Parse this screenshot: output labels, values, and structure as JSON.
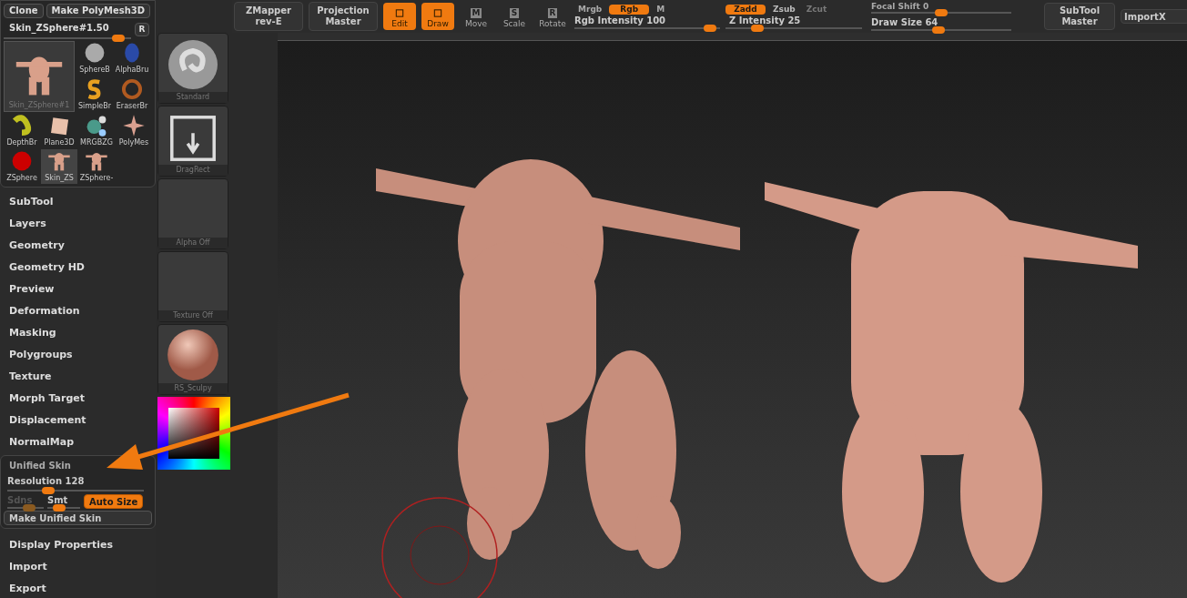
{
  "tool_palette": {
    "buttons": [
      "Clone",
      "Make PolyMesh3D"
    ],
    "current_tool": {
      "label": "Skin_ZSphere#1.50",
      "level": 0.9
    },
    "reset_button": "R",
    "tools": [
      {
        "label": "Skin_ZSphere#1",
        "kind": "figure",
        "selected": true
      },
      {
        "label": "SphereB",
        "kind": "sphere",
        "selected": false
      },
      {
        "label": "AlphaBru",
        "kind": "alpha",
        "selected": false
      },
      {
        "label": "SimpleBr",
        "kind": "simple",
        "selected": false
      },
      {
        "label": "EraserBr",
        "kind": "eraser",
        "selected": false
      },
      {
        "label": "DepthBr",
        "kind": "depth",
        "selected": false
      },
      {
        "label": "Plane3D",
        "kind": "plane",
        "selected": false
      },
      {
        "label": "MRGBZG",
        "kind": "mrgb",
        "selected": false
      },
      {
        "label": "PolyMes",
        "kind": "star",
        "selected": false
      },
      {
        "label": "ZSphere",
        "kind": "zsphere",
        "selected": false
      },
      {
        "label": "Skin_ZS",
        "kind": "figure",
        "selected": true
      },
      {
        "label": "ZSphere-",
        "kind": "figure",
        "selected": false
      }
    ]
  },
  "menus_top": [
    "SubTool",
    "Layers",
    "Geometry",
    "Geometry HD",
    "Preview",
    "Deformation",
    "Masking",
    "Polygroups",
    "Texture",
    "Morph Target",
    "Displacement",
    "NormalMap"
  ],
  "unified_skin": {
    "title": "Unified Skin",
    "expanded": true,
    "resolution": {
      "label": "Resolution 128",
      "level": 0.3
    },
    "sdns": {
      "label": "Sdns",
      "disabled": true,
      "level": 0.6
    },
    "smt": {
      "label": "Smt",
      "disabled": false,
      "level": 0.35
    },
    "auto_size": {
      "label": "Auto Size",
      "on": true
    },
    "make_button": "Make Unified Skin"
  },
  "menus_bottom": [
    "Display Properties",
    "Import",
    "Export"
  ],
  "shelf": [
    {
      "label": "Standard",
      "kind": "brush"
    },
    {
      "label": "DragRect",
      "kind": "stroke"
    },
    {
      "label": "Alpha Off",
      "kind": "empty"
    },
    {
      "label": "Texture Off",
      "kind": "empty"
    },
    {
      "label": "RS_Sculpy",
      "kind": "material"
    }
  ],
  "top_bar": {
    "zmapper": [
      "ZMapper",
      "rev-E"
    ],
    "projection": [
      "Projection",
      "Master"
    ],
    "transform": [
      {
        "label": "Edit",
        "on": true
      },
      {
        "label": "Draw",
        "on": true
      },
      {
        "label": "Move",
        "key": "M",
        "on": false
      },
      {
        "label": "Scale",
        "key": "S",
        "on": false
      },
      {
        "label": "Rotate",
        "key": "R",
        "on": false
      }
    ],
    "rgb_modes": [
      {
        "label": "Mrgb",
        "selected": false
      },
      {
        "label": "Rgb",
        "selected": true
      },
      {
        "label": "M",
        "selected": false
      }
    ],
    "z_modes": [
      {
        "label": "Zadd",
        "selected": true,
        "disabled": false
      },
      {
        "label": "Zsub",
        "selected": false,
        "disabled": false
      },
      {
        "label": "Zcut",
        "selected": false,
        "disabled": true
      }
    ],
    "sliders": [
      {
        "label": "Rgb Intensity 100",
        "level": 0.93
      },
      {
        "label": "Z Intensity 25",
        "level": 0.23
      },
      {
        "label": "Focal Shift 0",
        "level": 0.5
      },
      {
        "label": "Draw Size 64",
        "level": 0.48
      }
    ],
    "subtool_master": [
      "SubTool",
      "Master"
    ],
    "importx": "ImportX"
  }
}
